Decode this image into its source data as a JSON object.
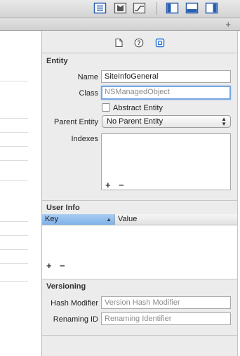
{
  "toolbar": {
    "icons": [
      "standard-editor-icon",
      "assistant-editor-icon",
      "version-editor-icon",
      "navigator-toggle-icon",
      "debug-area-toggle-icon",
      "utilities-toggle-icon"
    ],
    "add_label": "+"
  },
  "inspector_tabs": [
    "file-inspector-icon",
    "quick-help-icon",
    "data-model-inspector-icon"
  ],
  "entity": {
    "title": "Entity",
    "name_label": "Name",
    "name_value": "SiteInfoGeneral",
    "class_label": "Class",
    "class_placeholder": "NSManagedObject",
    "abstract_label": "Abstract Entity",
    "abstract_checked": false,
    "parent_label": "Parent Entity",
    "parent_value": "No Parent Entity",
    "indexes_label": "Indexes",
    "add": "+",
    "remove": "−"
  },
  "user_info": {
    "title": "User Info",
    "columns": [
      "Key",
      "Value"
    ],
    "add": "+",
    "remove": "−"
  },
  "versioning": {
    "title": "Versioning",
    "hash_label": "Hash Modifier",
    "hash_placeholder": "Version Hash Modifier",
    "renaming_label": "Renaming ID",
    "renaming_placeholder": "Renaming Identifier"
  },
  "colors": {
    "accent": "#1e6fd9",
    "selected_header": "#8fbdee"
  }
}
